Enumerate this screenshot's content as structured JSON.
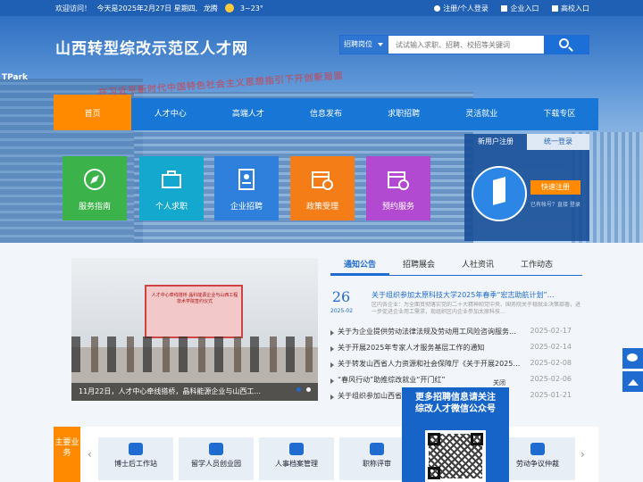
{
  "topbar": {
    "welcome": "欢迎访问！",
    "today": "今天是2025年2月27日 星期四,",
    "city": "龙腾",
    "weather": "3~23°",
    "links": [
      "注册/个人登录",
      "企业入口",
      "高校入口"
    ]
  },
  "header": {
    "site_title": "山西转型综改示范区人才网",
    "brand_mark": "TPark",
    "slogan": "在习近平新时代中国特色社会主义思想指引下开创新局面",
    "search": {
      "category": "招聘岗位",
      "placeholder": "试试输入求职、招聘、校招等关键词"
    }
  },
  "nav": {
    "items": [
      "首页",
      "人才中心",
      "高端人才",
      "信息发布",
      "求职招聘",
      "灵活就业",
      "下载专区"
    ],
    "active_index": 0
  },
  "tiles": [
    "服务指南",
    "个人求职",
    "企业招聘",
    "政策受理",
    "预约服务"
  ],
  "login": {
    "tabs": [
      "新用户注册",
      "统一登录"
    ],
    "register_button": "快速注册",
    "note": "已有帐号？直接 登录"
  },
  "carousel": {
    "screen_text": "人才中心牵线搭桥 晶科能源企业与山西工程技术学院签约仪式",
    "caption": "11月22日，人才中心牵线搭桥，晶科能源企业与山西工..."
  },
  "news": {
    "tabs": [
      "通知公告",
      "招聘展会",
      "人社资讯",
      "工作动态"
    ],
    "featured": {
      "day": "26",
      "year_month": "2025-02",
      "title": "关于组织参加太原科技大学2025年春季“宏志助航计划”…",
      "desc": "区内各企业：为全面贯彻落实党的二十大精神和党中央、国务院关于稳就业决策部署，进一步促进企业用工需求，现组织区内企业参加太原科技…"
    },
    "items": [
      {
        "title": "关于为企业提供劳动法律法规及劳动用工风险咨询服务的…",
        "date": "2025-02-17"
      },
      {
        "title": "关于开展2025年专家人才服务基层工作的通知",
        "date": "2025-02-14"
      },
      {
        "title": "关于转发山西省人力资源和社会保障厅《关于开展2025年…",
        "date": "2025-02-08"
      },
      {
        "title": "“春风行动”助推综改就业“开门红”",
        "date": "2025-02-06"
      },
      {
        "title": "关于组织参加山西省…",
        "date": "2025-01-21"
      }
    ]
  },
  "wechat": {
    "close": "关闭",
    "title_line1": "更多招聘信息请关注",
    "title_line2": "综改人才微信公众号"
  },
  "business": {
    "title": "主要业务",
    "cards": [
      "博士后工作站",
      "留学人员创业园",
      "人事档案管理",
      "职称评审",
      "劳动争议仲裁"
    ]
  }
}
